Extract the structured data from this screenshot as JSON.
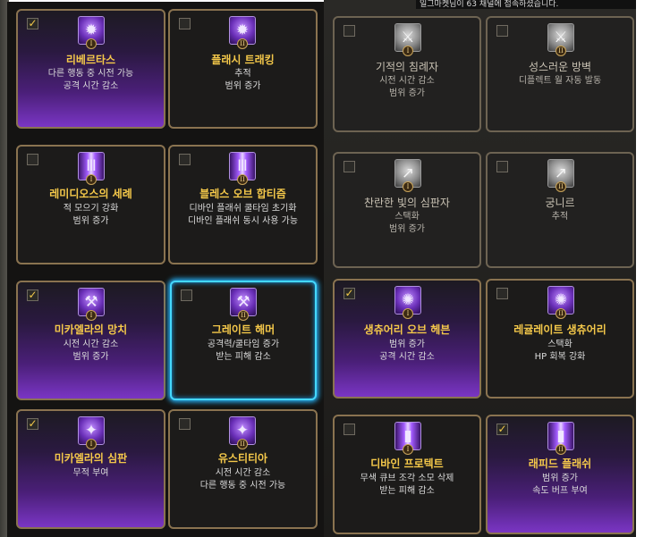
{
  "top_message": "일그마켓님이 63 채널에 접속하셨습니다.",
  "colors": {
    "accent_gold": "#f4c84a",
    "frame": "#8a7350",
    "highlight": "#44d8ff",
    "purple_glow": "#7a35c4"
  },
  "left_cards": [
    {
      "title": "리베르타스",
      "lines": [
        "다른 행동 중 시전 가능",
        "공격 시간 감소"
      ],
      "checked": true,
      "tier": "I",
      "icon": "sunburst-icon"
    },
    {
      "title": "플래시 트래킹",
      "lines": [
        "추적",
        "범위 증가"
      ],
      "checked": false,
      "tier": "II",
      "icon": "sunburst-icon"
    },
    {
      "title": "레미디오스의 세례",
      "lines": [
        "적 모으기 강화",
        "범위 증가"
      ],
      "checked": false,
      "tier": "I",
      "icon": "light-pillar-icon"
    },
    {
      "title": "블레스 오브 합티즘",
      "lines": [
        "디바인 플래쉬 쿨타임 초기화",
        "디바인 플래쉬 동시 사용 가능"
      ],
      "checked": false,
      "tier": "II",
      "icon": "light-pillar-icon"
    },
    {
      "title": "미카엘라의 망치",
      "lines": [
        "시전 시간 감소",
        "범위 증가"
      ],
      "checked": true,
      "tier": "I",
      "icon": "hammer-icon"
    },
    {
      "title": "그레이트 해머",
      "lines": [
        "공격력/쿨타임 증가",
        "받는 피해 감소"
      ],
      "checked": false,
      "tier": "II",
      "icon": "hammer-icon"
    },
    {
      "title": "미카엘라의 심판",
      "lines": [
        "무적 부여"
      ],
      "checked": true,
      "tier": "I",
      "icon": "wings-icon"
    },
    {
      "title": "유스티티아",
      "lines": [
        "시전 시간 감소",
        "다른 행동 중 시전 가능"
      ],
      "checked": false,
      "tier": "II",
      "icon": "wings-icon"
    }
  ],
  "right_cards": [
    {
      "title": "기적의 침례자",
      "lines": [
        "시전 시간 감소",
        "범위 증가"
      ],
      "checked": false,
      "tier": "I",
      "icon": "sword-icon"
    },
    {
      "title": "성스러운 방벽",
      "lines": [
        "디플렉트 월 자동 발동"
      ],
      "checked": false,
      "tier": "II",
      "icon": "sword-icon"
    },
    {
      "title": "찬란한 빛의 심판자",
      "lines": [
        "스택화",
        "범위 증가"
      ],
      "checked": false,
      "tier": "I",
      "icon": "spear-icon"
    },
    {
      "title": "궁니르",
      "lines": [
        "추적"
      ],
      "checked": false,
      "tier": "II",
      "icon": "spear-icon"
    },
    {
      "title": "생츄어리 오브 헤븐",
      "lines": [
        "범위 증가",
        "공격 시간 감소"
      ],
      "checked": true,
      "tier": "I",
      "icon": "sanctuary-icon"
    },
    {
      "title": "레귤레이트 생츄어리",
      "lines": [
        "스택화",
        "HP 회복 강화"
      ],
      "checked": false,
      "tier": "II",
      "icon": "sanctuary-icon"
    },
    {
      "title": "디바인 프로텍트",
      "lines": [
        "무색 큐브 조각 소모 삭제",
        "받는 피해 감소"
      ],
      "checked": false,
      "tier": "I",
      "icon": "shield-light-icon"
    },
    {
      "title": "래피드 플래쉬",
      "lines": [
        "범위 증가",
        "속도 버프 부여"
      ],
      "checked": true,
      "tier": "II",
      "icon": "shield-light-icon"
    }
  ]
}
